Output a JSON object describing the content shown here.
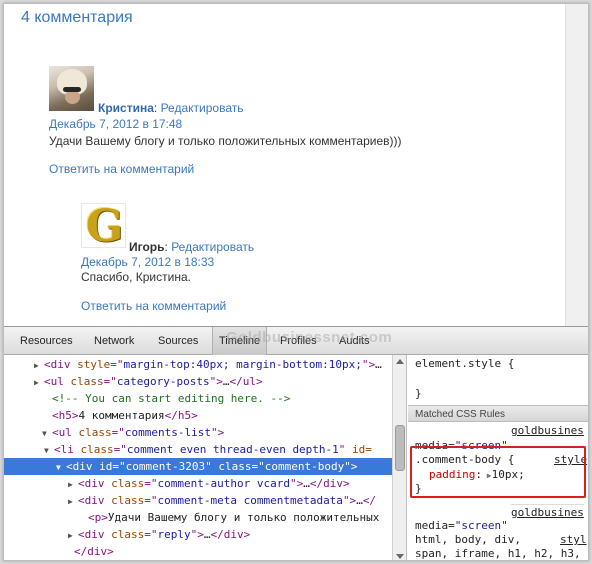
{
  "page": {
    "comments_title": "4 комментария",
    "comments": [
      {
        "author": "Кристина",
        "colon": ":",
        "edit_link": "Редактировать",
        "date": "Декабрь 7, 2012 в 17:48",
        "text": "Удачи Вашему блогу и только положительных комментариев)))",
        "reply": "Ответить на комментарий",
        "avatar": "user-photo-avatar"
      },
      {
        "author": "Игорь",
        "colon": ":",
        "edit_link": "Редактировать",
        "date": "Декабрь 7, 2012 в 18:33",
        "text": "Спасибо, Кристина.",
        "reply": "Ответить на комментарий",
        "avatar": "gold-g-logo-avatar",
        "avatar_letter": "G"
      }
    ]
  },
  "devtools": {
    "tabs": [
      "Resources",
      "Network",
      "Sources",
      "Timeline",
      "Profiles",
      "Audits"
    ],
    "active_tab": "Timeline",
    "watermark": "Goldbusinessnet.com",
    "elements": [
      {
        "tri": "▶",
        "parts": [
          [
            "tag",
            "<div "
          ],
          [
            "attr",
            "style"
          ],
          [
            "tag",
            "=\""
          ],
          [
            "val",
            "margin-top:40px; margin-bottom:10px;"
          ],
          [
            "tag",
            "\">"
          ],
          [
            "txt",
            "…"
          ]
        ]
      },
      {
        "tri": "▶",
        "parts": [
          [
            "tag",
            "<ul "
          ],
          [
            "attr",
            "class"
          ],
          [
            "tag",
            "=\""
          ],
          [
            "val",
            "category-posts"
          ],
          [
            "tag",
            "\">"
          ],
          [
            "txt",
            "…"
          ],
          [
            "tag",
            "</ul>"
          ]
        ]
      },
      {
        "tri": "",
        "parts": [
          [
            "cmt",
            "<!-- You can start editing here. -->"
          ]
        ]
      },
      {
        "tri": "",
        "parts": [
          [
            "tag",
            "<h5>"
          ],
          [
            "txt",
            "4 комментария"
          ],
          [
            "tag",
            "</h5>"
          ]
        ]
      },
      {
        "tri": "▼",
        "parts": [
          [
            "tag",
            "<ul "
          ],
          [
            "attr",
            "class"
          ],
          [
            "tag",
            "=\""
          ],
          [
            "val",
            "comments-list"
          ],
          [
            "tag",
            "\">"
          ]
        ]
      },
      {
        "tri": "▼",
        "parts": [
          [
            "tag",
            "<li "
          ],
          [
            "attr",
            "class"
          ],
          [
            "tag",
            "=\""
          ],
          [
            "val",
            "comment even thread-even depth-1"
          ],
          [
            "tag",
            "\" "
          ],
          [
            "attr",
            "id="
          ]
        ]
      },
      {
        "tri": "▼",
        "parts": [
          [
            "tag",
            "<div "
          ],
          [
            "attr",
            "id"
          ],
          [
            "tag",
            "=\""
          ],
          [
            "val",
            "comment-3203"
          ],
          [
            "tag",
            "\" "
          ],
          [
            "attr",
            "class"
          ],
          [
            "tag",
            "=\""
          ],
          [
            "val",
            "comment-body"
          ],
          [
            "tag",
            "\">"
          ]
        ]
      },
      {
        "tri": "▶",
        "parts": [
          [
            "tag",
            "<div "
          ],
          [
            "attr",
            "class"
          ],
          [
            "tag",
            "=\""
          ],
          [
            "val",
            "comment-author vcard"
          ],
          [
            "tag",
            "\">"
          ],
          [
            "txt",
            "…"
          ],
          [
            "tag",
            "</div>"
          ]
        ]
      },
      {
        "tri": "▶",
        "parts": [
          [
            "tag",
            "<div "
          ],
          [
            "attr",
            "class"
          ],
          [
            "tag",
            "=\""
          ],
          [
            "val",
            "comment-meta commentmetadata"
          ],
          [
            "tag",
            "\">"
          ],
          [
            "txt",
            "…"
          ],
          [
            "tag",
            "</"
          ]
        ]
      },
      {
        "tri": "",
        "parts": [
          [
            "tag",
            "<p>"
          ],
          [
            "txt",
            "Удачи Вашему блогу и только  положительных"
          ]
        ]
      },
      {
        "tri": "▶",
        "parts": [
          [
            "tag",
            "<div "
          ],
          [
            "attr",
            "class"
          ],
          [
            "tag",
            "=\""
          ],
          [
            "val",
            "reply"
          ],
          [
            "tag",
            "\">"
          ],
          [
            "txt",
            "…"
          ],
          [
            "tag",
            "</div>"
          ]
        ]
      },
      {
        "tri": "",
        "parts": [
          [
            "tag",
            "</div>"
          ]
        ]
      }
    ],
    "selected_row": 6,
    "styles": {
      "element_style_open": "element.style {",
      "element_style_close": "}",
      "matched_header": "Matched CSS Rules",
      "rule1_source": "goldbusines",
      "rule1_media_label": "media=",
      "rule1_media_value": "\"screen\"",
      "rule1_selector": ".comment-body {",
      "rule1_link": "style",
      "rule1_prop": "padding",
      "rule1_colon": ":",
      "rule1_value": "10px;",
      "rule1_close": "}",
      "rule2_source": "goldbusines",
      "rule2_media_label": "media=",
      "rule2_media_value": "\"screen\"",
      "rule2_selector": "html, body, div,",
      "rule2_link": "styl",
      "rule2_line2": "span, iframe, h1, h2, h3,"
    }
  },
  "colors": {
    "link": "#3a78c0",
    "selection": "#3879d9",
    "highlight_box": "#d42020"
  }
}
